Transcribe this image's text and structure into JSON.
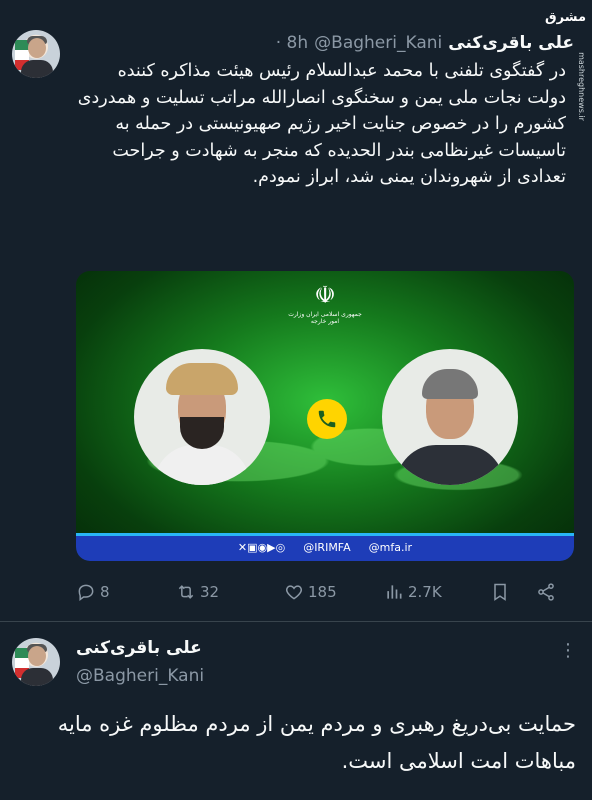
{
  "tweet1": {
    "author_name": "علی باقری‌کنی",
    "handle": "@Bagheri_Kani",
    "time": "· 8h",
    "text": "در گفتگوی تلفنی با محمد عبدالسلام رئیس هیئت مذاکره کننده دولت نجات ملی یمن و سخنگوی انصارالله مراتب تسلیت و همدردی کشورم را در خصوص جنایت اخیر رژیم صهیونیستی در حمله به تاسیسات غیرنظامی بندر الحدیده که منجر به شهادت و جراحت تعدادی از شهروندان یمنی شد، ابراز نمودم.",
    "media": {
      "footer_handle": "@IRIMFA",
      "footer_site": "@mfa.ir",
      "emblem_text": "جمهوری اسلامی ایران\nوزارت امور خارجه"
    },
    "actions": {
      "replies": "8",
      "retweets": "32",
      "likes": "185",
      "views": "2.7K"
    }
  },
  "tweet2": {
    "author_name": "علی باقری‌کنی",
    "handle": "@Bagheri_Kani",
    "text": "حمایت بی‌دریغ رهبری و مردم یمن از مردم مظلوم غزه مایه مباهات امت اسلامی است."
  },
  "watermark": {
    "logo": "مشرق",
    "site": "mashreghnews.ir"
  },
  "colors": {
    "background": "#15202b",
    "text": "#f7f9f9",
    "muted": "#8b98a5",
    "divider": "#38444d"
  }
}
